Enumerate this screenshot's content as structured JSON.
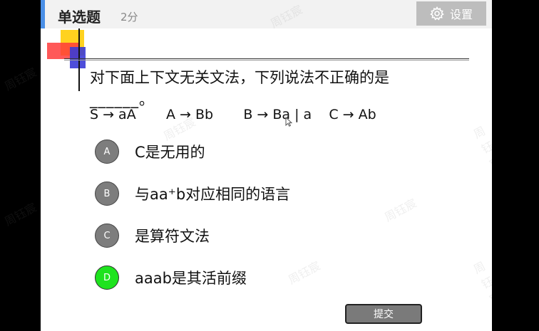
{
  "header": {
    "question_type": "单选题",
    "score": "2分",
    "settings_label": "设置"
  },
  "question": {
    "stem": "对下面上下文无关文法，下列说法不正确的是",
    "blank": "______。",
    "grammar": "S → aA       A → Bb       B → Ba | a    C → Ab"
  },
  "options": [
    {
      "letter": "A",
      "text": "C是无用的",
      "selected": false
    },
    {
      "letter": "B",
      "text": "与aa⁺b对应相同的语言",
      "selected": false
    },
    {
      "letter": "C",
      "text": "是算符文法",
      "selected": false
    },
    {
      "letter": "D",
      "text": "aaab是其活前缀",
      "selected": true
    }
  ],
  "submit_label": "提交",
  "watermark": "周钰宸",
  "colors": {
    "selected": "#1ee31e",
    "unselected": "#7d7d7d",
    "accent": "#4a8fe7"
  }
}
